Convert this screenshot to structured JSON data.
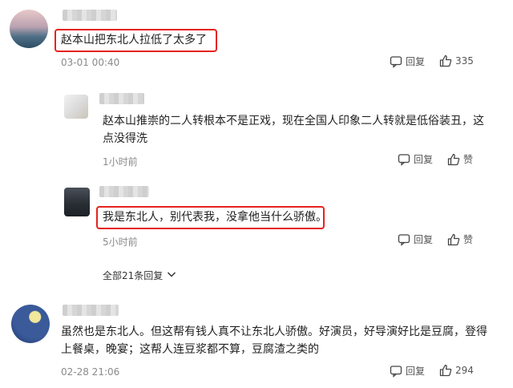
{
  "comments": [
    {
      "content": "赵本山把东北人拉低了太多了",
      "time": "03-01 00:40",
      "reply_label": "回复",
      "like_count": "335"
    },
    {
      "content_line1": "赵本山推崇的二人转根本不是正戏，现在全国人印象二人转就是低俗装丑，这",
      "content_line2": "点没得洗",
      "time": "1小时前",
      "reply_label": "回复",
      "like_label": "赞"
    },
    {
      "content": "我是东北人，别代表我，没拿他当什么骄傲。",
      "time": "5小时前",
      "reply_label": "回复",
      "like_label": "赞"
    },
    {
      "content_line1": "虽然也是东北人。但这帮有钱人真不让东北人骄傲。好演员，好导演好比是豆腐，登得",
      "content_line2": "上餐桌，晚宴；这帮人连豆浆都不算，豆腐渣之类的",
      "time": "02-28 21:06",
      "reply_label": "回复",
      "like_count": "294"
    }
  ],
  "replies_toggle": {
    "label": "全部21条回复"
  },
  "icons": [
    "reply-icon",
    "thumbs-up-icon",
    "chevron-down-icon"
  ],
  "colors": {
    "highlight": "#e5231f",
    "meta": "#8a8a8a"
  }
}
